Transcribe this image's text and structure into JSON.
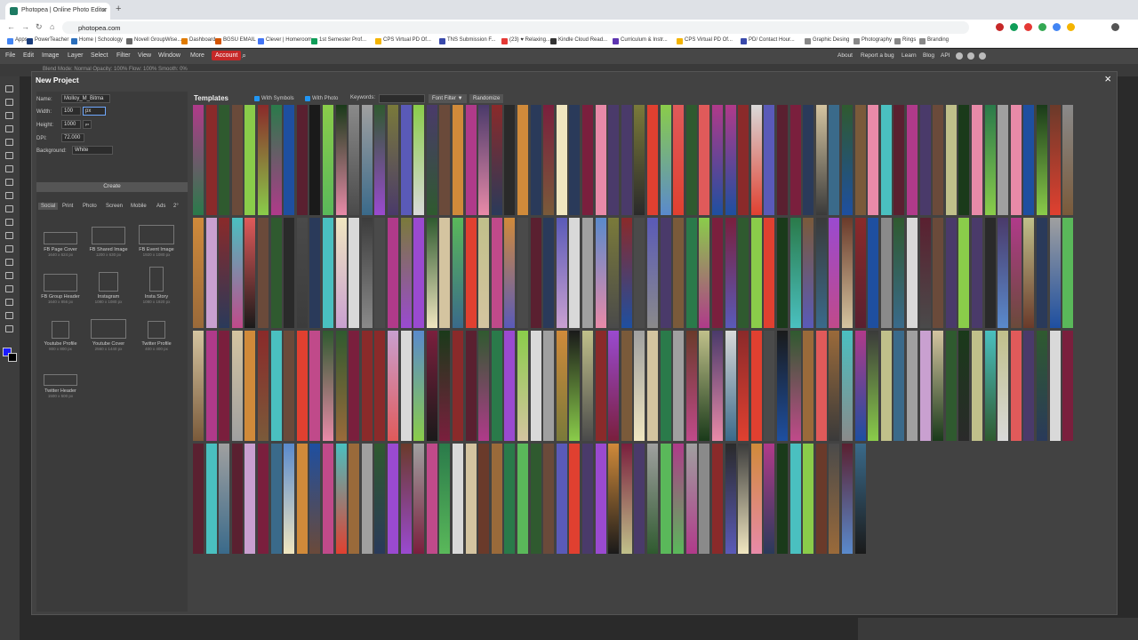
{
  "browser": {
    "tab_title": "Photopea | Online Photo Editor",
    "tab_close": "×",
    "new_tab": "+",
    "url": "photopea.com",
    "bookmarks": [
      {
        "label": "Apps",
        "color": "#4285f4"
      },
      {
        "label": "PowerTeacher",
        "color": "#1a3d7c"
      },
      {
        "label": "Home | Schoology",
        "color": "#2a6ebb"
      },
      {
        "label": "Novell GroupWise...",
        "color": "#666666"
      },
      {
        "label": "Dashboard",
        "color": "#e07b00"
      },
      {
        "label": "BGSU EMAIL",
        "color": "#d35400"
      },
      {
        "label": "Clever | Homeroom",
        "color": "#4274f6"
      },
      {
        "label": "1st Semester Prof...",
        "color": "#0f9d58"
      },
      {
        "label": "CPS Virtual PD Of...",
        "color": "#f4b400"
      },
      {
        "label": "TNS Submission F...",
        "color": "#3949ab"
      },
      {
        "label": "(23) ♥ Relaxing...",
        "color": "#e53935"
      },
      {
        "label": "Kindle Cloud Read...",
        "color": "#333333"
      },
      {
        "label": "Curriculum & Instr...",
        "color": "#5e35b1"
      },
      {
        "label": "CPS Virtual PD Of...",
        "color": "#f4b400"
      },
      {
        "label": "PD/ Contact Hour...",
        "color": "#3949ab"
      },
      {
        "label": "Graphic Desing",
        "color": "#888888"
      },
      {
        "label": "Photography",
        "color": "#888888"
      },
      {
        "label": "Rings",
        "color": "#888888"
      },
      {
        "label": "Branding",
        "color": "#888888"
      }
    ]
  },
  "menubar": {
    "items": [
      "File",
      "Edit",
      "Image",
      "Layer",
      "Select",
      "Filter",
      "View",
      "Window",
      "More",
      "Account"
    ],
    "right_items": [
      "About",
      "Report a bug",
      "Learn",
      "Blog",
      "API"
    ]
  },
  "options_bar": {
    "text": "Blend Mode:  Normal        Opacity: 100%       Flow: 100%      Smooth: 0%"
  },
  "dialog": {
    "title": "New Project",
    "close": "×",
    "fields": {
      "name_label": "Name:",
      "name_value": "Molloy_M_Bitma",
      "width_label": "Width:",
      "width_value": "100",
      "width_unit": "px",
      "height_label": "Height:",
      "height_value": "1000",
      "height_unit": "px",
      "dpi_label": "DPI:",
      "dpi_value": "72.000",
      "background_label": "Background:",
      "background_value": "White"
    },
    "create_label": "Create",
    "preset_tabs": [
      "Social",
      "Print",
      "Photo",
      "Screen",
      "Mobile",
      "Ads",
      "2°"
    ],
    "presets": [
      {
        "name": "FB Page Cover",
        "size": "1640 x 624 px"
      },
      {
        "name": "FB Shared Image",
        "size": "1200 x 630 px"
      },
      {
        "name": "FB Event Image",
        "size": "1920 x 1080 px"
      },
      {
        "name": "FB Group Header",
        "size": "1640 x 856 px"
      },
      {
        "name": "Instagram",
        "size": "1080 x 1080 px"
      },
      {
        "name": "Insta Story",
        "size": "1080 x 1920 px"
      },
      {
        "name": "Youtube Profile",
        "size": "800 x 800 px"
      },
      {
        "name": "Youtube Cover",
        "size": "2560 x 1440 px"
      },
      {
        "name": "Twitter Profile",
        "size": "400 x 400 px"
      },
      {
        "name": "Twitter Header",
        "size": "1500 x 500 px"
      }
    ],
    "templates": {
      "title": "Templates",
      "with_symbols": "With Symbols",
      "with_photo": "With Photo",
      "keywords_label": "Keywords:",
      "font_filter": "Font Filter ▼",
      "randomize": "Randomize"
    }
  },
  "template_palette": [
    "#7a1f3d",
    "#3c3c3c",
    "#1e4fa0",
    "#2f5a2f",
    "#5a2030",
    "#d9d9d9",
    "#e04030",
    "#1a1a1a",
    "#f0e6c0",
    "#8a2a2a",
    "#2a2a2a",
    "#5ab85a",
    "#7a5a3a",
    "#4a4a4a",
    "#3a6a8a",
    "#c9a0d0",
    "#6a4a3a",
    "#e88aa8",
    "#4a3a6a",
    "#b03a8a",
    "#9a6a3a",
    "#8a8a8a",
    "#2a7a4a",
    "#c04a8a",
    "#5a5ab8",
    "#3a3a3a",
    "#8acc4a",
    "#6a3a2a",
    "#d4c4a0",
    "#2a3a5a",
    "#a0a0a0",
    "#c0c08a",
    "#3a5a3a",
    "#e05a5a",
    "#5a8acc",
    "#7a7a3a",
    "#4ac0c0",
    "#9a4ad0",
    "#d08a3a",
    "#1a3a1a"
  ]
}
